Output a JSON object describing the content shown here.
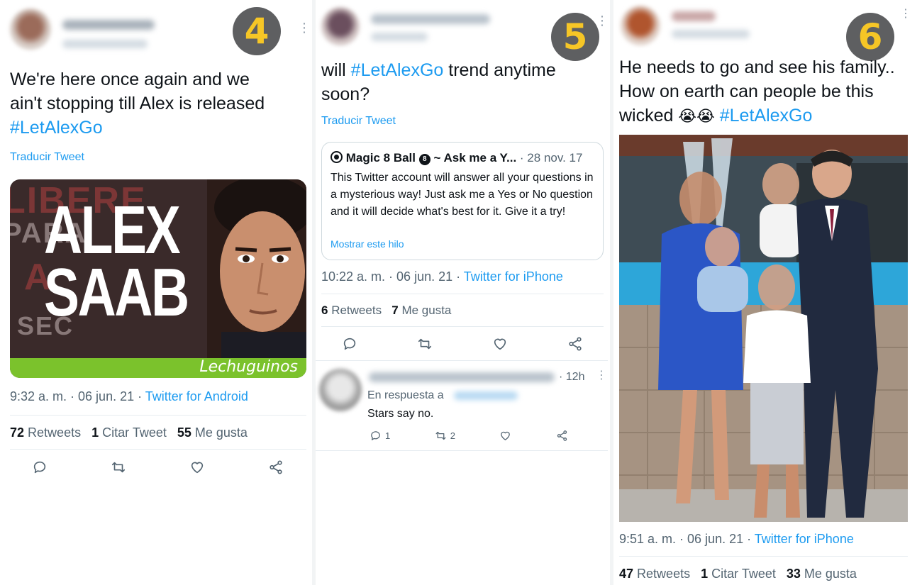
{
  "tweet4": {
    "badge": "4",
    "text_line1": "We're here once again and we",
    "text_line2": "ain't stopping till Alex is released",
    "hashtag": "#LetAlexGo",
    "translate": "Traducir Tweet",
    "media": {
      "title_line1": "ALEX",
      "title_line2": "SAAB",
      "brand": "Lechuguinos"
    },
    "timestamp": "9:32 a. m. · 06 jun. 21 · ",
    "source": "Twitter for Android",
    "retweets_count": "72",
    "retweets_label": "Retweets",
    "quotes_count": "1",
    "quotes_label": "Citar Tweet",
    "likes_count": "55",
    "likes_label": "Me gusta",
    "icons": [
      "reply-icon",
      "retweet-icon",
      "like-icon",
      "share-icon"
    ]
  },
  "tweet5": {
    "badge": "5",
    "text_prefix": "will ",
    "hashtag": "#LetAlexGo",
    "text_suffix": " trend anytime",
    "text_line2": "soon?",
    "translate": "Traducir Tweet",
    "quote": {
      "author": "Magic 8 Ball",
      "tagline": "~ Ask me a Y...",
      "date": "· 28 nov. 17",
      "body": "This Twitter account will answer all your questions in a mysterious way! Just ask me a Yes or No question and it will decide what's best for it. Give it a try!",
      "link": "Mostrar este hilo"
    },
    "timestamp": "10:22 a. m. · 06 jun. 21 · ",
    "source": "Twitter for iPhone",
    "retweets_count": "6",
    "retweets_label": "Retweets",
    "likes_count": "7",
    "likes_label": "Me gusta",
    "reply": {
      "time": "· 12h",
      "in_reply_to": "En respuesta a",
      "text": "Stars say no.",
      "reply_count": "1",
      "retweet_count": "2"
    }
  },
  "tweet6": {
    "badge": "6",
    "text_line1": "He needs to go and see his family..",
    "text_line2": "How on earth can people be this",
    "text_line3": "wicked ",
    "emoji": "😭😭",
    "hashtag": "#LetAlexGo",
    "timestamp": "9:51 a. m. · 06 jun. 21 · ",
    "source": "Twitter for iPhone",
    "retweets_count": "47",
    "retweets_label": "Retweets",
    "quotes_count": "1",
    "quotes_label": "Citar Tweet",
    "likes_count": "33",
    "likes_label": "Me gusta"
  },
  "colors": {
    "link": "#1d9bf0",
    "text": "#0f1419",
    "muted": "#536471",
    "badge_bg": "#5e5f61",
    "badge_fg": "#f6c626",
    "brand_green": "#7bc22c"
  }
}
